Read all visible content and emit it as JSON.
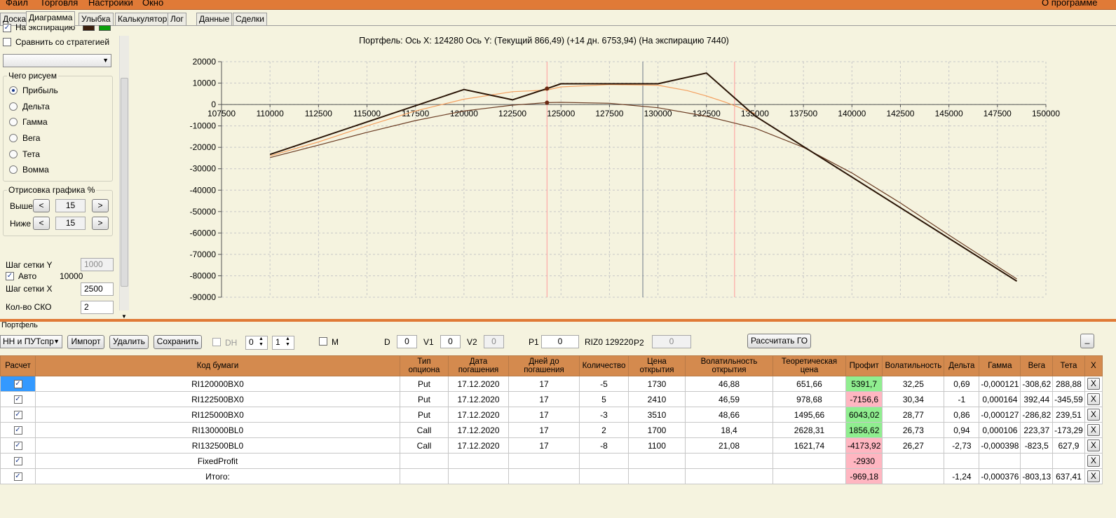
{
  "menu": {
    "items": [
      "Файл",
      "Торговля",
      "Настройки",
      "Окно"
    ],
    "about": "О программе"
  },
  "tabs": [
    "Доска",
    "Диаграмма",
    "Улыбка",
    "Калькулятор",
    "Лог",
    "Данные",
    "Сделки"
  ],
  "active_tab": "Диаграмма",
  "left": {
    "expiry_label": "На экспирацию",
    "expiry_checked": true,
    "expiry_colors": [
      "#3b1f0d",
      "#0aa00a"
    ],
    "compare_label": "Сравнить со стратегией",
    "compare_checked": false,
    "strategy_select": "",
    "draw_group": "Чего рисуем",
    "radios": [
      "Прибыль",
      "Дельта",
      "Гамма",
      "Вега",
      "Тета",
      "Вомма"
    ],
    "selected_radio": 0,
    "render_group": "Отрисовка графика %",
    "above_label": "Выше",
    "above_value": "15",
    "below_label": "Ниже",
    "below_value": "15",
    "prev_btn": "<",
    "next_btn": ">",
    "grid_y_label": "Шаг сетки Y",
    "grid_y_value": "1000",
    "auto_label": "Авто",
    "auto_checked": true,
    "auto_value": "10000",
    "grid_x_label": "Шаг сетки X",
    "grid_x_value": "2500",
    "sko_label": "Кол-во СКО",
    "sko_value": "2"
  },
  "chart_data": {
    "type": "line",
    "title": "Портфель: Ось X: 124280 Ось Y:  (Текущий 866,49)  (+14 дн. 6753,94)  (На экспирацию 7440)",
    "xlim": [
      107500,
      150000
    ],
    "ylim": [
      -90000,
      20000
    ],
    "x_ticks": [
      107500,
      110000,
      112500,
      115000,
      117500,
      120000,
      122500,
      125000,
      127500,
      130000,
      132500,
      135000,
      137500,
      140000,
      142500,
      145000,
      147500,
      150000
    ],
    "y_ticks": [
      20000,
      10000,
      0,
      -10000,
      -20000,
      -30000,
      -40000,
      -50000,
      -60000,
      -70000,
      -80000,
      -90000
    ],
    "grid": true,
    "vertical_lines": [
      {
        "x": 124280,
        "color": "#ff9a9a"
      },
      {
        "x": 129220,
        "color": "#6e7a8a"
      },
      {
        "x": 133950,
        "color": "#ff9a9a"
      }
    ],
    "series": [
      {
        "color": "#2a1506",
        "x": [
          110000,
          120000,
          122500,
          124280,
          125000,
          130000,
          132500,
          135000,
          148500
        ],
        "values": [
          -23300,
          7000,
          2200,
          7440,
          9700,
          9700,
          14700,
          -5300,
          -82500
        ]
      },
      {
        "color": "#f4a060",
        "x": [
          110000,
          112500,
          115000,
          117500,
          120000,
          122500,
          124280,
          125000,
          127500,
          130000,
          131500,
          132500,
          133500,
          135000
        ],
        "values": [
          -24000,
          -17500,
          -10000,
          -3000,
          2500,
          6000,
          6754,
          8200,
          9300,
          9000,
          6500,
          4000,
          1000,
          -4200
        ]
      },
      {
        "color": "#6b3d24",
        "x": [
          110000,
          112500,
          115000,
          117500,
          120000,
          122500,
          124280,
          125000,
          127500,
          130000,
          132500,
          135000,
          137500,
          140000,
          142500,
          145000,
          148500
        ],
        "values": [
          -24800,
          -19000,
          -13000,
          -7500,
          -3000,
          -300,
          866,
          1000,
          600,
          -1500,
          -5500,
          -11000,
          -20000,
          -32000,
          -46000,
          -61000,
          -81500
        ]
      }
    ],
    "markers": [
      {
        "x": 124280,
        "y": 7440,
        "color": "#6b2a12"
      },
      {
        "x": 124280,
        "y": 866,
        "color": "#6b2a12"
      }
    ]
  },
  "portfolio": {
    "label": "Портфель",
    "selector": "НН и ПУТспр",
    "import_btn": "Импорт",
    "delete_btn": "Удалить",
    "save_btn": "Сохранить",
    "dh_label": "DH",
    "dh_checked": false,
    "spin1": "0",
    "spin2": "1",
    "m_label": "M",
    "m_checked": false,
    "d_label": "D",
    "d_value": "0",
    "v1_label": "V1",
    "v1_value": "0",
    "v2_label": "V2",
    "v2_value": "0",
    "p1_label": "P1",
    "p1_value": "0",
    "riz_label": "RIZ0 129220",
    "p2_label": "P2",
    "p2_value": "0",
    "calc_btn": "Рассчитать ГО",
    "min_btn": "_"
  },
  "table": {
    "columns": [
      "Расчет",
      "Код бумаги",
      "Тип опциона",
      "Дата погашения",
      "Дней до погашения",
      "Количество",
      "Цена открытия",
      "Волатильность открытия",
      "Теоретическая цена",
      "Профит",
      "Волатильность",
      "Дельта",
      "Гамма",
      "Вега",
      "Тета",
      "X"
    ],
    "rows": [
      {
        "calc": true,
        "code": "RI120000BX0",
        "type": "Put",
        "date": "17.12.2020",
        "days": "17",
        "qty": "-5",
        "price": "1730",
        "vol_open": "46,88",
        "theo": "651,66",
        "profit": "5391,7",
        "profit_sign": "pos",
        "vol": "32,25",
        "delta": "0,69",
        "gamma": "-0,000121",
        "vega": "-308,62",
        "theta": "288,88",
        "x": "X"
      },
      {
        "calc": true,
        "code": "RI122500BX0",
        "type": "Put",
        "date": "17.12.2020",
        "days": "17",
        "qty": "5",
        "price": "2410",
        "vol_open": "46,59",
        "theo": "978,68",
        "profit": "-7156,6",
        "profit_sign": "neg",
        "vol": "30,34",
        "delta": "-1",
        "gamma": "0,000164",
        "vega": "392,44",
        "theta": "-345,59",
        "x": "X"
      },
      {
        "calc": true,
        "code": "RI125000BX0",
        "type": "Put",
        "date": "17.12.2020",
        "days": "17",
        "qty": "-3",
        "price": "3510",
        "vol_open": "48,66",
        "theo": "1495,66",
        "profit": "6043,02",
        "profit_sign": "pos",
        "vol": "28,77",
        "delta": "0,86",
        "gamma": "-0,000127",
        "vega": "-286,82",
        "theta": "239,51",
        "x": "X"
      },
      {
        "calc": true,
        "code": "RI130000BL0",
        "type": "Call",
        "date": "17.12.2020",
        "days": "17",
        "qty": "2",
        "price": "1700",
        "vol_open": "18,4",
        "theo": "2628,31",
        "profit": "1856,62",
        "profit_sign": "pos",
        "vol": "26,73",
        "delta": "0,94",
        "gamma": "0,000106",
        "vega": "223,37",
        "theta": "-173,29",
        "x": "X"
      },
      {
        "calc": true,
        "code": "RI132500BL0",
        "type": "Call",
        "date": "17.12.2020",
        "days": "17",
        "qty": "-8",
        "price": "1100",
        "vol_open": "21,08",
        "theo": "1621,74",
        "profit": "-4173,92",
        "profit_sign": "neg",
        "vol": "26,27",
        "delta": "-2,73",
        "gamma": "-0,000398",
        "vega": "-823,5",
        "theta": "627,9",
        "x": "X"
      },
      {
        "calc": true,
        "code": "FixedProfit",
        "type": "",
        "date": "",
        "days": "",
        "qty": "",
        "price": "",
        "vol_open": "",
        "theo": "",
        "profit": "-2930",
        "profit_sign": "neg",
        "vol": "",
        "delta": "",
        "gamma": "",
        "vega": "",
        "theta": "",
        "x": "X"
      },
      {
        "calc": true,
        "code": "Итого:",
        "type": "",
        "date": "",
        "days": "",
        "qty": "",
        "price": "",
        "vol_open": "",
        "theo": "",
        "profit": "-969,18",
        "profit_sign": "neg",
        "vol": "",
        "delta": "-1,24",
        "gamma": "-0,000376",
        "vega": "-803,13",
        "theta": "637,41",
        "x": "X"
      }
    ]
  }
}
